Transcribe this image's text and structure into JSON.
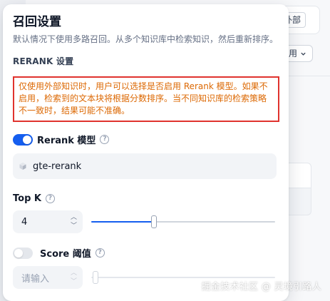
{
  "background": {
    "chip_label": "外部",
    "select_label": "用",
    "select_icon": "chevron-down-icon"
  },
  "panel": {
    "title": "召回设置",
    "description": "默认情况下使用多路召回。从多个知识库中检索知识，然后重新排序。",
    "section_label": "RERANK 设置",
    "warning": "仅使用外部知识时，用户可以选择是否启用 Rerank 模型。如果不启用，检索到的文本块将根据分数排序。当不同知识库的检索策略不一致时，结果可能不准确。",
    "rerank": {
      "label": "Rerank 模型",
      "enabled": true,
      "model": "gte-rerank",
      "model_icon": "cube-icon"
    },
    "top_k": {
      "label": "Top K",
      "value": "4",
      "slider_fraction": 0.34
    },
    "score": {
      "label": "Score 阈值",
      "enabled": false,
      "placeholder": "请输入",
      "slider_fraction": 0.0
    },
    "help_icon": "question-circle-icon"
  },
  "watermark": "掘金技术社区 @ 灵境引路人",
  "colors": {
    "accent": "#155eef",
    "warning_text": "#dc6803",
    "warning_border": "#e0332e"
  }
}
